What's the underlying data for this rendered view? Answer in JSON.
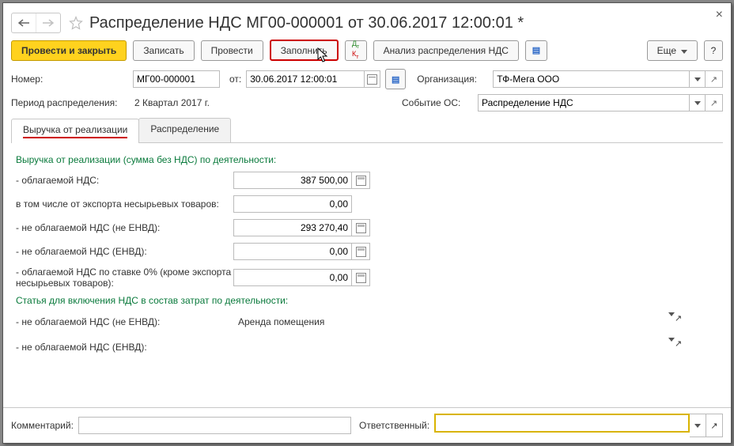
{
  "title": "Распределение НДС МГ00-000001 от 30.06.2017 12:00:01 *",
  "toolbar": {
    "commit_close": "Провести и закрыть",
    "save": "Записать",
    "commit": "Провести",
    "fill": "Заполнить",
    "analysis": "Анализ распределения НДС",
    "more": "Еще",
    "help": "?"
  },
  "header": {
    "number_label": "Номер:",
    "number": "МГ00-000001",
    "from_label": "от:",
    "date": "30.06.2017 12:00:01",
    "org_label": "Организация:",
    "org_value": "ТФ-Мега ООО",
    "period_label": "Период распределения:",
    "period_value": "2 Квартал 2017  г.",
    "event_label": "Событие ОС:",
    "event_value": "Распределение НДС"
  },
  "tabs": {
    "t1": "Выручка от реализации",
    "t2": "Распределение"
  },
  "revenue": {
    "section1": "Выручка от реализации (сумма без НДС) по деятельности:",
    "r1_label": "- облагаемой НДС:",
    "r1_value": "387 500,00",
    "r2_label": "в том числе от экспорта несырьевых товаров:",
    "r2_value": "0,00",
    "r3_label": "- не облагаемой НДС (не ЕНВД):",
    "r3_value": "293 270,40",
    "r4_label": "- не облагаемой НДС (ЕНВД):",
    "r4_value": "0,00",
    "r5_label": "- облагаемой НДС по ставке 0% (кроме экспорта несырьевых товаров):",
    "r5_value": "0,00",
    "section2": "Статья для включения НДС в состав затрат по деятельности:",
    "s1_label": "- не облагаемой НДС (не ЕНВД):",
    "s1_value": "Аренда помещения",
    "s2_label": "- не облагаемой НДС (ЕНВД):",
    "s2_value": ""
  },
  "footer": {
    "comment_label": "Комментарий:",
    "comment_value": "",
    "resp_label": "Ответственный:",
    "resp_value": ""
  }
}
